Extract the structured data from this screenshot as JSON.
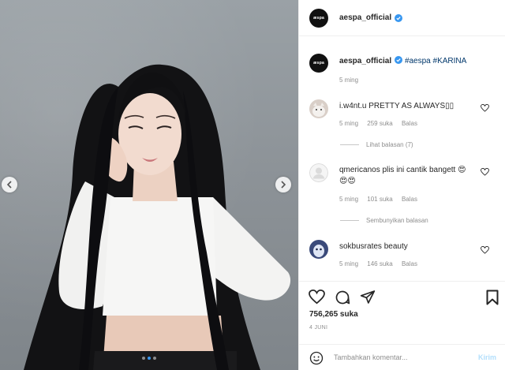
{
  "post": {
    "account": "aespa_official",
    "avatar_text": "æspa",
    "caption_tags": "#aespa #KARINA",
    "caption_time": "5 ming",
    "likes": "756,265 suka",
    "date": "4 JUNI"
  },
  "comments": [
    {
      "username": "i.w4nt.u",
      "text": "PRETTY AS ALWAYS▯▯",
      "time": "5 ming",
      "likes": "259 suka",
      "reply_label": "Balas",
      "toggle": "Lihat balasan (7)"
    },
    {
      "username": "qmericanos",
      "text": "plis ini cantik bangett 😍😍😍",
      "time": "5 ming",
      "likes": "101 suka",
      "reply_label": "Balas",
      "toggle": "Sembunyikan balasan"
    },
    {
      "username": "sokbusrates",
      "text": "beauty",
      "time": "5 ming",
      "likes": "146 suka",
      "reply_label": "Balas"
    }
  ],
  "comment_box": {
    "placeholder": "Tambahkan komentar...",
    "post_label": "Kirim"
  },
  "colors": {
    "verified": "#3897f0",
    "link": "#00376b",
    "muted": "#8e8e8e",
    "post_button_disabled": "#b2dffc"
  },
  "icons": [
    "chevron-left-icon",
    "chevron-right-icon",
    "verified-badge-icon",
    "heart-icon",
    "comment-icon",
    "share-icon",
    "bookmark-icon",
    "emoji-icon"
  ]
}
